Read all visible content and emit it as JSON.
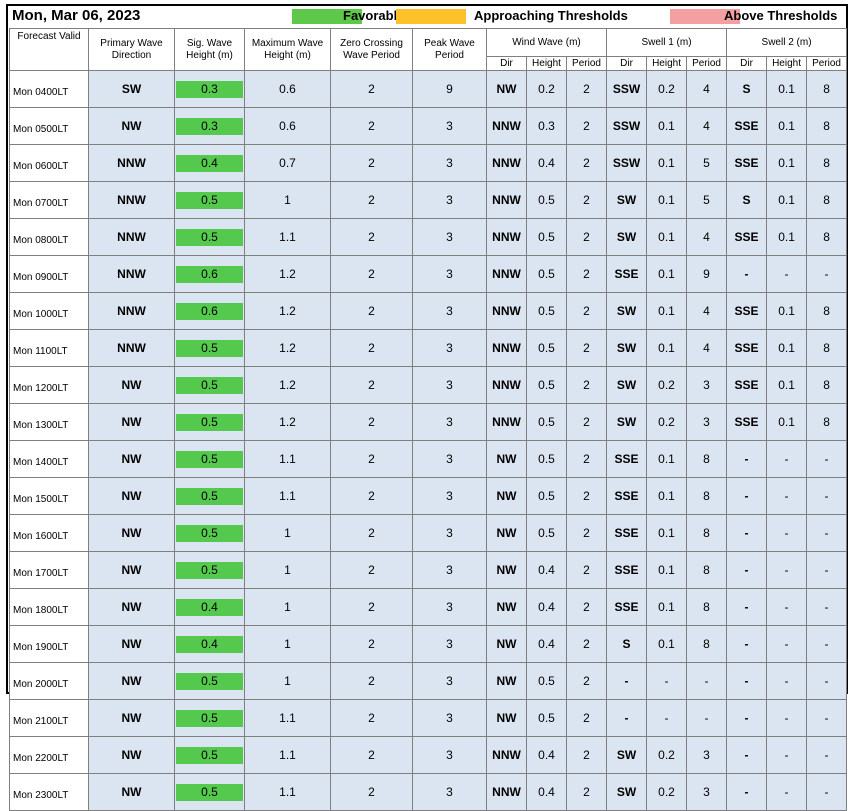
{
  "header": {
    "date": "Mon, Mar 06, 2023",
    "legend": [
      {
        "label": "Favorable",
        "color": "#5ec84b"
      },
      {
        "label": "Approaching Thresholds",
        "color": "#fdc22a"
      },
      {
        "label": "Above Thresholds",
        "color": "#f4a0a3"
      }
    ]
  },
  "columns": {
    "forecast_valid": "Forecast Valid",
    "primary_dir": "Primary Wave Direction",
    "sig_height": "Sig. Wave Height (m)",
    "max_height": "Maximum Wave Height (m)",
    "zero_crossing": "Zero Crossing Wave Period",
    "peak_period": "Peak Wave Period",
    "wind_wave": "Wind Wave (m)",
    "swell1": "Swell 1 (m)",
    "swell2": "Swell 2 (m)",
    "sub_dir": "Dir",
    "sub_height": "Height",
    "sub_period": "Period"
  },
  "rows": [
    {
      "time": "Mon 0400LT",
      "dir": "SW",
      "sig": "0.3",
      "max": "0.6",
      "zc": "2",
      "pk": "9",
      "ww_dir": "NW",
      "ww_h": "0.2",
      "ww_p": "2",
      "s1_dir": "SSW",
      "s1_h": "0.2",
      "s1_p": "4",
      "s2_dir": "S",
      "s2_h": "0.1",
      "s2_p": "8"
    },
    {
      "time": "Mon 0500LT",
      "dir": "NW",
      "sig": "0.3",
      "max": "0.6",
      "zc": "2",
      "pk": "3",
      "ww_dir": "NNW",
      "ww_h": "0.3",
      "ww_p": "2",
      "s1_dir": "SSW",
      "s1_h": "0.1",
      "s1_p": "4",
      "s2_dir": "SSE",
      "s2_h": "0.1",
      "s2_p": "8"
    },
    {
      "time": "Mon 0600LT",
      "dir": "NNW",
      "sig": "0.4",
      "max": "0.7",
      "zc": "2",
      "pk": "3",
      "ww_dir": "NNW",
      "ww_h": "0.4",
      "ww_p": "2",
      "s1_dir": "SSW",
      "s1_h": "0.1",
      "s1_p": "5",
      "s2_dir": "SSE",
      "s2_h": "0.1",
      "s2_p": "8"
    },
    {
      "time": "Mon 0700LT",
      "dir": "NNW",
      "sig": "0.5",
      "max": "1",
      "zc": "2",
      "pk": "3",
      "ww_dir": "NNW",
      "ww_h": "0.5",
      "ww_p": "2",
      "s1_dir": "SW",
      "s1_h": "0.1",
      "s1_p": "5",
      "s2_dir": "S",
      "s2_h": "0.1",
      "s2_p": "8"
    },
    {
      "time": "Mon 0800LT",
      "dir": "NNW",
      "sig": "0.5",
      "max": "1.1",
      "zc": "2",
      "pk": "3",
      "ww_dir": "NNW",
      "ww_h": "0.5",
      "ww_p": "2",
      "s1_dir": "SW",
      "s1_h": "0.1",
      "s1_p": "4",
      "s2_dir": "SSE",
      "s2_h": "0.1",
      "s2_p": "8"
    },
    {
      "time": "Mon 0900LT",
      "dir": "NNW",
      "sig": "0.6",
      "max": "1.2",
      "zc": "2",
      "pk": "3",
      "ww_dir": "NNW",
      "ww_h": "0.5",
      "ww_p": "2",
      "s1_dir": "SSE",
      "s1_h": "0.1",
      "s1_p": "9",
      "s2_dir": "-",
      "s2_h": "-",
      "s2_p": "-"
    },
    {
      "time": "Mon 1000LT",
      "dir": "NNW",
      "sig": "0.6",
      "max": "1.2",
      "zc": "2",
      "pk": "3",
      "ww_dir": "NNW",
      "ww_h": "0.5",
      "ww_p": "2",
      "s1_dir": "SW",
      "s1_h": "0.1",
      "s1_p": "4",
      "s2_dir": "SSE",
      "s2_h": "0.1",
      "s2_p": "8"
    },
    {
      "time": "Mon 1100LT",
      "dir": "NNW",
      "sig": "0.5",
      "max": "1.2",
      "zc": "2",
      "pk": "3",
      "ww_dir": "NNW",
      "ww_h": "0.5",
      "ww_p": "2",
      "s1_dir": "SW",
      "s1_h": "0.1",
      "s1_p": "4",
      "s2_dir": "SSE",
      "s2_h": "0.1",
      "s2_p": "8"
    },
    {
      "time": "Mon 1200LT",
      "dir": "NW",
      "sig": "0.5",
      "max": "1.2",
      "zc": "2",
      "pk": "3",
      "ww_dir": "NNW",
      "ww_h": "0.5",
      "ww_p": "2",
      "s1_dir": "SW",
      "s1_h": "0.2",
      "s1_p": "3",
      "s2_dir": "SSE",
      "s2_h": "0.1",
      "s2_p": "8"
    },
    {
      "time": "Mon 1300LT",
      "dir": "NW",
      "sig": "0.5",
      "max": "1.2",
      "zc": "2",
      "pk": "3",
      "ww_dir": "NNW",
      "ww_h": "0.5",
      "ww_p": "2",
      "s1_dir": "SW",
      "s1_h": "0.2",
      "s1_p": "3",
      "s2_dir": "SSE",
      "s2_h": "0.1",
      "s2_p": "8"
    },
    {
      "time": "Mon 1400LT",
      "dir": "NW",
      "sig": "0.5",
      "max": "1.1",
      "zc": "2",
      "pk": "3",
      "ww_dir": "NW",
      "ww_h": "0.5",
      "ww_p": "2",
      "s1_dir": "SSE",
      "s1_h": "0.1",
      "s1_p": "8",
      "s2_dir": "-",
      "s2_h": "-",
      "s2_p": "-"
    },
    {
      "time": "Mon 1500LT",
      "dir": "NW",
      "sig": "0.5",
      "max": "1.1",
      "zc": "2",
      "pk": "3",
      "ww_dir": "NW",
      "ww_h": "0.5",
      "ww_p": "2",
      "s1_dir": "SSE",
      "s1_h": "0.1",
      "s1_p": "8",
      "s2_dir": "-",
      "s2_h": "-",
      "s2_p": "-"
    },
    {
      "time": "Mon 1600LT",
      "dir": "NW",
      "sig": "0.5",
      "max": "1",
      "zc": "2",
      "pk": "3",
      "ww_dir": "NW",
      "ww_h": "0.5",
      "ww_p": "2",
      "s1_dir": "SSE",
      "s1_h": "0.1",
      "s1_p": "8",
      "s2_dir": "-",
      "s2_h": "-",
      "s2_p": "-"
    },
    {
      "time": "Mon 1700LT",
      "dir": "NW",
      "sig": "0.5",
      "max": "1",
      "zc": "2",
      "pk": "3",
      "ww_dir": "NW",
      "ww_h": "0.4",
      "ww_p": "2",
      "s1_dir": "SSE",
      "s1_h": "0.1",
      "s1_p": "8",
      "s2_dir": "-",
      "s2_h": "-",
      "s2_p": "-"
    },
    {
      "time": "Mon 1800LT",
      "dir": "NW",
      "sig": "0.4",
      "max": "1",
      "zc": "2",
      "pk": "3",
      "ww_dir": "NW",
      "ww_h": "0.4",
      "ww_p": "2",
      "s1_dir": "SSE",
      "s1_h": "0.1",
      "s1_p": "8",
      "s2_dir": "-",
      "s2_h": "-",
      "s2_p": "-"
    },
    {
      "time": "Mon 1900LT",
      "dir": "NW",
      "sig": "0.4",
      "max": "1",
      "zc": "2",
      "pk": "3",
      "ww_dir": "NW",
      "ww_h": "0.4",
      "ww_p": "2",
      "s1_dir": "S",
      "s1_h": "0.1",
      "s1_p": "8",
      "s2_dir": "-",
      "s2_h": "-",
      "s2_p": "-"
    },
    {
      "time": "Mon 2000LT",
      "dir": "NW",
      "sig": "0.5",
      "max": "1",
      "zc": "2",
      "pk": "3",
      "ww_dir": "NW",
      "ww_h": "0.5",
      "ww_p": "2",
      "s1_dir": "-",
      "s1_h": "-",
      "s1_p": "-",
      "s2_dir": "-",
      "s2_h": "-",
      "s2_p": "-"
    },
    {
      "time": "Mon 2100LT",
      "dir": "NW",
      "sig": "0.5",
      "max": "1.1",
      "zc": "2",
      "pk": "3",
      "ww_dir": "NW",
      "ww_h": "0.5",
      "ww_p": "2",
      "s1_dir": "-",
      "s1_h": "-",
      "s1_p": "-",
      "s2_dir": "-",
      "s2_h": "-",
      "s2_p": "-"
    },
    {
      "time": "Mon 2200LT",
      "dir": "NW",
      "sig": "0.5",
      "max": "1.1",
      "zc": "2",
      "pk": "3",
      "ww_dir": "NNW",
      "ww_h": "0.4",
      "ww_p": "2",
      "s1_dir": "SW",
      "s1_h": "0.2",
      "s1_p": "3",
      "s2_dir": "-",
      "s2_h": "-",
      "s2_p": "-"
    },
    {
      "time": "Mon 2300LT",
      "dir": "NW",
      "sig": "0.5",
      "max": "1.1",
      "zc": "2",
      "pk": "3",
      "ww_dir": "NNW",
      "ww_h": "0.4",
      "ww_p": "2",
      "s1_dir": "SW",
      "s1_h": "0.2",
      "s1_p": "3",
      "s2_dir": "-",
      "s2_h": "-",
      "s2_p": "-"
    }
  ]
}
